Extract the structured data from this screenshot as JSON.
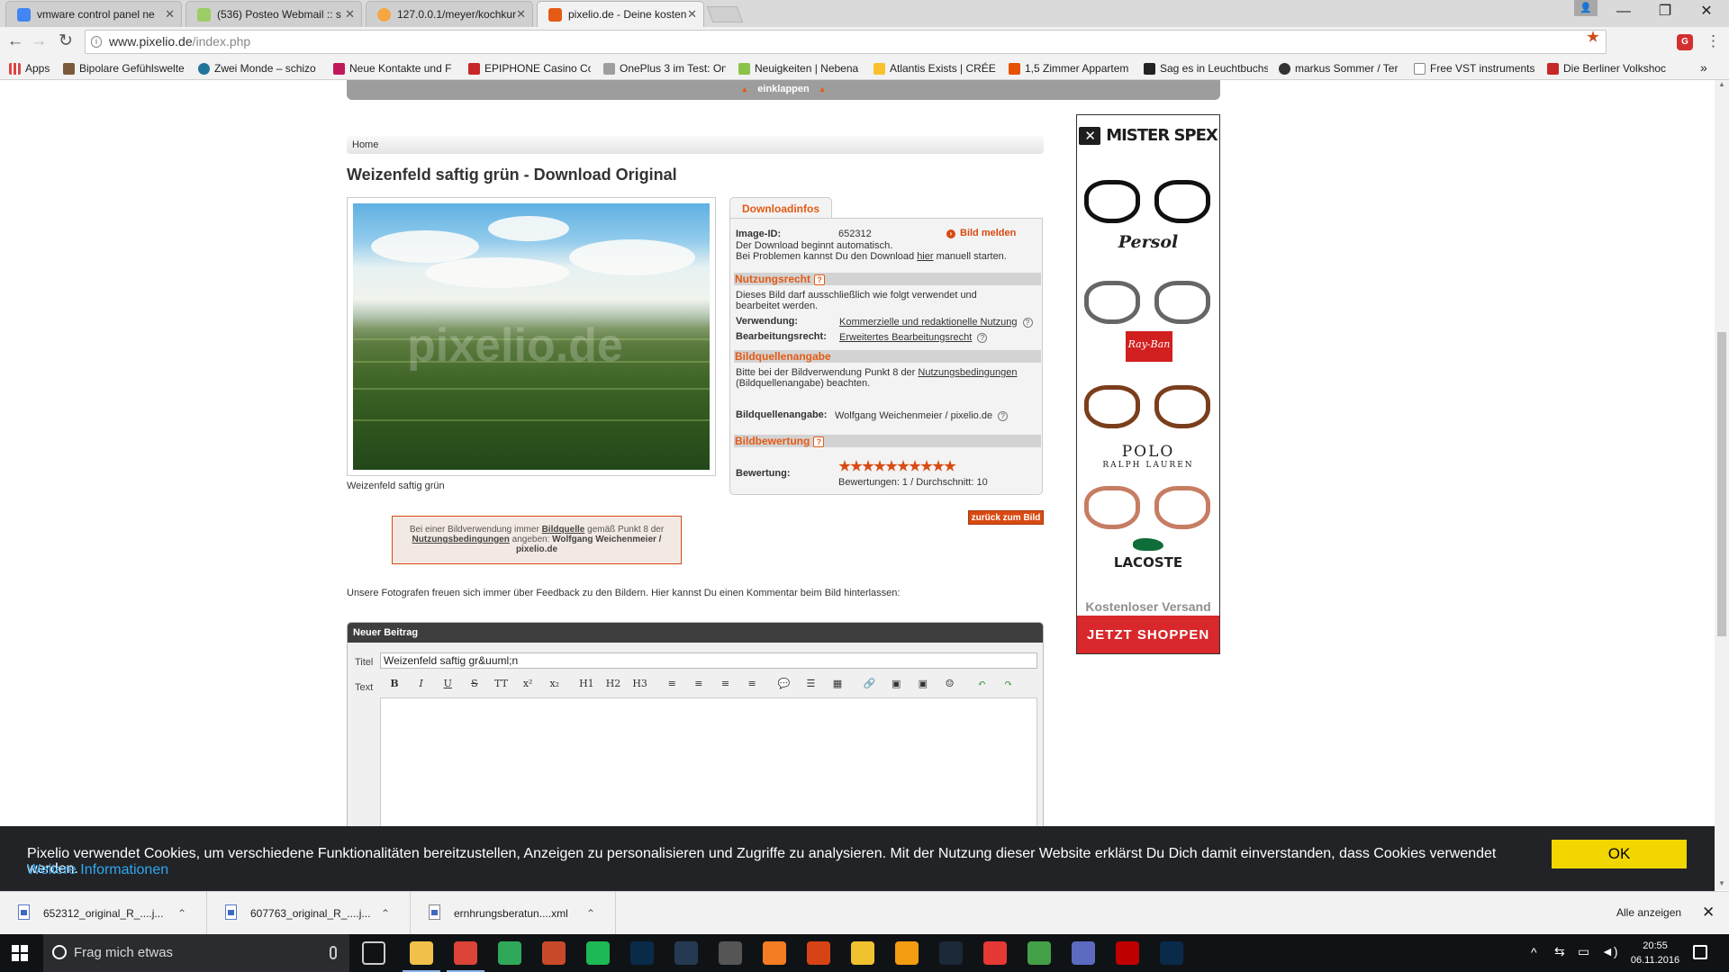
{
  "browser": {
    "tabs": [
      {
        "title": "vmware control panel ne",
        "color": "#4285f4",
        "active": false
      },
      {
        "title": "(536) Posteo Webmail :: s",
        "color": "#9ccc65",
        "active": false
      },
      {
        "title": "127.0.0.1/meyer/kochkur",
        "color": "#f4a742",
        "active": false
      },
      {
        "title": "pixelio.de - Deine kosten",
        "color": "#e55a14",
        "active": true
      }
    ],
    "tab_close": "✕",
    "url_host": "www.pixelio.de",
    "url_path": "/index.php",
    "bookmarks": [
      {
        "label": "Apps",
        "color": "#d44"
      },
      {
        "label": "Bipolare Gefühlswelte",
        "color": "#7a5a3a"
      },
      {
        "label": "Zwei Monde – schizo",
        "color": "#21759b"
      },
      {
        "label": "Neue Kontakte und F",
        "color": "#c2185b"
      },
      {
        "label": "EPIPHONE Casino Co",
        "color": "#c62828"
      },
      {
        "label": "OnePlus 3 im Test: On",
        "color": "#9e9e9e"
      },
      {
        "label": "Neuigkeiten | Nebena",
        "color": "#8bc34a"
      },
      {
        "label": "Atlantis Exists | CRÉER",
        "color": "#fbc02d"
      },
      {
        "label": "1,5 Zimmer Appartem",
        "color": "#e65100"
      },
      {
        "label": "Sag es in Leuchtbuchs",
        "color": "#222"
      },
      {
        "label": "markus Sommer / Ter",
        "color": "#333"
      },
      {
        "label": "Free VST instruments",
        "color": "#aaa"
      },
      {
        "label": "Die Berliner Volkshoc",
        "color": "#c62828"
      }
    ],
    "more": "»"
  },
  "page": {
    "collapse_label": "einklappen",
    "breadcrumb": "Home",
    "title": "Weizenfeld saftig grün - Download Original",
    "photo_watermark": "pixelio.de",
    "photo_caption": "Weizenfeld saftig grün",
    "download_tab": "Downloadinfos",
    "image_id_label": "Image-ID:",
    "image_id": "652312",
    "report_label": "Bild melden",
    "auto_download_line1": "Der Download beginnt automatisch.",
    "auto_download_pre": "Bei Problemen kannst Du den Download",
    "auto_download_link": "hier",
    "auto_download_post": "manuell starten.",
    "usage_section": "Nutzungsrecht",
    "usage_text": "Dieses Bild darf ausschließlich wie folgt verwendet und bearbeitet werden.",
    "usage_label": "Verwendung:",
    "usage_value": "Kommerzielle und redaktionelle Nutzung",
    "edit_label": "Bearbeitungsrecht:",
    "edit_value": "Erweitertes Bearbeitungsrecht",
    "source_section": "Bildquellenangabe",
    "source_text_pre": "Bitte bei der Bildverwendung Punkt 8 der",
    "source_text_link": "Nutzungsbedingungen",
    "source_text_post": "(Bildquellenangabe) beachten.",
    "source_label": "Bildquellenangabe:",
    "source_value": "Wolfgang Weichenmeier  / pixelio.de",
    "rating_section": "Bildbewertung",
    "rating_label": "Bewertung:",
    "rating_stars": 10,
    "rating_summary": "Bewertungen: 1 / Durchschnitt: 10",
    "back_button": "zurück zum Bild",
    "credit_pre": "Bei einer Bildverwendung immer",
    "credit_link1": "Bildquelle",
    "credit_mid": "gemäß Punkt 8 der",
    "credit_link2": "Nutzungsbedingungen",
    "credit_post": "angeben:",
    "credit_name": "Wolfgang Weichenmeier  /  pixelio.de",
    "feedback_text": "Unsere Fotografen freuen sich immer über Feedback zu den Bildern. Hier kannst Du einen Kommentar beim Bild hinterlassen:",
    "post_header": "Neuer Beitrag",
    "title_label": "Titel",
    "title_value": "Weizenfeld saftig gr&uuml;n",
    "text_label": "Text",
    "editor_tools": [
      "B",
      "I",
      "U",
      "S",
      "TT",
      "x²",
      "x₂",
      "H1",
      "H2",
      "H3",
      "≡",
      "≡",
      "≡",
      "≡",
      "💬",
      "☰",
      "▦",
      "🔗",
      "▣",
      "▣",
      "☺",
      "↶",
      "↷"
    ]
  },
  "ad": {
    "logo": "MISTER SPEX",
    "brands": [
      "Persol",
      "Ray-Ban",
      "POLO",
      "RALPH LAUREN",
      "LACOSTE"
    ],
    "shipping": "Kostenloser Versand",
    "cta": "JETZT SHOPPEN"
  },
  "cookie": {
    "text": "Pixelio verwendet Cookies, um verschiedene Funktionalitäten bereitzustellen, Anzeigen zu personalisieren und Zugriffe zu analysieren. Mit der Nutzung dieser Website erklärst Du Dich damit einverstanden, dass Cookies verwendet werden.",
    "more": "Weitere Informationen",
    "ok": "OK"
  },
  "downloads": {
    "items": [
      "652312_original_R_....j...",
      "607763_original_R_....j...",
      "ernhrungsberatun....xml"
    ],
    "show_all": "Alle anzeigen"
  },
  "taskbar": {
    "search_placeholder": "Frag mich etwas",
    "time": "20:55",
    "date": "06.11.2016",
    "apps": [
      {
        "name": "file-explorer",
        "color": "#f2c04a"
      },
      {
        "name": "chrome",
        "color": "#db4437"
      },
      {
        "name": "app-green",
        "color": "#30a85a"
      },
      {
        "name": "app-shield",
        "color": "#c94a2a"
      },
      {
        "name": "spotify",
        "color": "#1db954"
      },
      {
        "name": "photoshop",
        "color": "#0a2a4a"
      },
      {
        "name": "lightroom",
        "color": "#253a52"
      },
      {
        "name": "app-camera",
        "color": "#555"
      },
      {
        "name": "xampp",
        "color": "#f57c22"
      },
      {
        "name": "app-pot",
        "color": "#d84315"
      },
      {
        "name": "app-triangle",
        "color": "#f0c230"
      },
      {
        "name": "overwatch",
        "color": "#f39c12"
      },
      {
        "name": "steam",
        "color": "#1b2838"
      },
      {
        "name": "app-red",
        "color": "#e53935"
      },
      {
        "name": "app-greenbox",
        "color": "#43a047"
      },
      {
        "name": "app-lock",
        "color": "#5c6bc0"
      },
      {
        "name": "filezilla",
        "color": "#bf0000"
      },
      {
        "name": "photoshop-2",
        "color": "#0a2a4a"
      }
    ]
  }
}
